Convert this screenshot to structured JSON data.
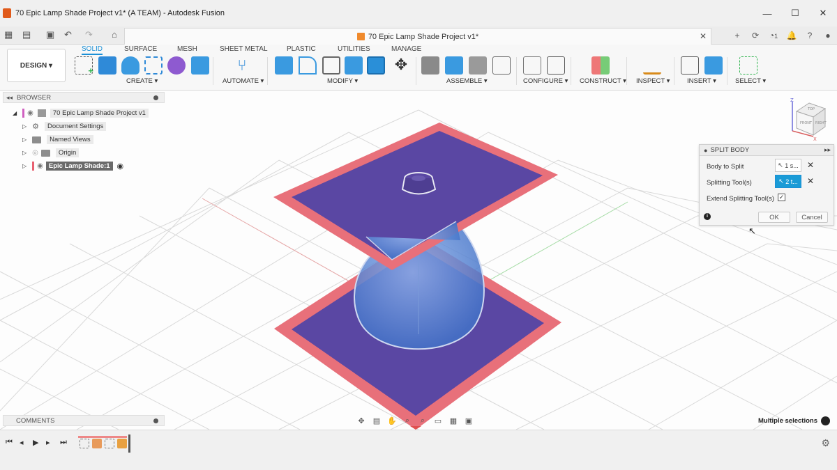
{
  "window": {
    "title": "70 Epic Lamp Shade Project v1* (A TEAM) - Autodesk Fusion",
    "controls": [
      "—",
      "☐",
      "✕"
    ]
  },
  "tab": {
    "title": "70 Epic Lamp Shade Project v1*",
    "notification_count": "1"
  },
  "toolbar": {
    "design_label": "DESIGN",
    "workspaces": [
      "SOLID",
      "SURFACE",
      "MESH",
      "SHEET METAL",
      "PLASTIC",
      "UTILITIES",
      "MANAGE"
    ],
    "groups": {
      "create": "CREATE",
      "automate": "AUTOMATE",
      "modify": "MODIFY",
      "assemble": "ASSEMBLE",
      "configure": "CONFIGURE",
      "construct": "CONSTRUCT",
      "inspect": "INSPECT",
      "insert": "INSERT",
      "select": "SELECT"
    }
  },
  "browser": {
    "title": "BROWSER",
    "root": "70 Epic Lamp Shade Project v1",
    "items": [
      "Document Settings",
      "Named Views",
      "Origin",
      "Epic Lamp Shade:1"
    ]
  },
  "dialog": {
    "title": "SPLIT BODY",
    "body_to_split_label": "Body to Split",
    "body_to_split_value": "1 s...",
    "splitting_tools_label": "Splitting Tool(s)",
    "splitting_tools_value": "2 t...",
    "extend_label": "Extend Splitting Tool(s)",
    "extend_checked": true,
    "ok_label": "OK",
    "cancel_label": "Cancel"
  },
  "comments": {
    "title": "COMMENTS"
  },
  "status": {
    "selection_text": "Multiple selections"
  },
  "viewcube": {
    "faces": [
      "TOP",
      "FRONT",
      "RIGHT"
    ],
    "axes": [
      "Z",
      "X"
    ]
  },
  "colors": {
    "accent": "#1a8fd6",
    "plane_fill": "#5a47a3",
    "plane_border": "#e8707a",
    "body": "#4f7fd0"
  }
}
